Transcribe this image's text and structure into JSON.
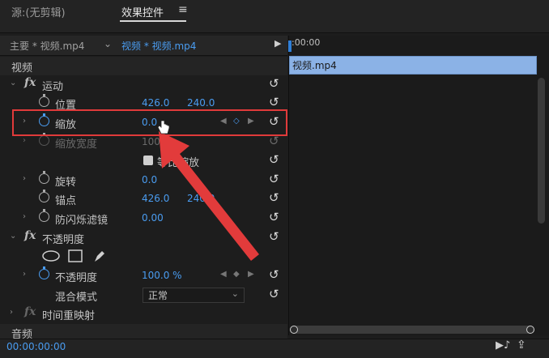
{
  "tabs": {
    "source": "源:(无剪辑)",
    "effects": "效果控件",
    "menu_icon": "≡"
  },
  "header": {
    "master_clip": "主要 * 视频.mp4",
    "sequence_clip": "视频 * 视频.mp4",
    "chevron": "⌄",
    "play_arrow": "▶"
  },
  "timeline": {
    "ruler_time": ":00:00",
    "clip_label": "视频.mp4"
  },
  "sections": {
    "video": "视频",
    "audio": "音频"
  },
  "motion": {
    "name": "运动",
    "position": {
      "label": "位置",
      "x": "426.0",
      "y": "240.0"
    },
    "scale": {
      "label": "缩放",
      "value": "0.0"
    },
    "scale_width": {
      "label": "缩放宽度",
      "value": "100.0"
    },
    "uniform_scale": {
      "label": "等比缩放"
    },
    "rotation": {
      "label": "旋转",
      "value": "0.0"
    },
    "anchor": {
      "label": "锚点",
      "x": "426.0",
      "y": "240.0"
    },
    "anti_flicker": {
      "label": "防闪烁滤镜",
      "value": "0.00"
    }
  },
  "opacity": {
    "name": "不透明度",
    "opacity": {
      "label": "不透明度",
      "value": "100.0 %"
    },
    "blend_mode": {
      "label": "混合模式",
      "value": "正常"
    }
  },
  "time_remap": {
    "name": "时间重映射"
  },
  "footer": {
    "timecode": "00:00:00:00"
  },
  "colors": {
    "accent": "#4a9cf0",
    "highlight": "#e03a3a",
    "clip_bar": "#8bb2e6"
  }
}
